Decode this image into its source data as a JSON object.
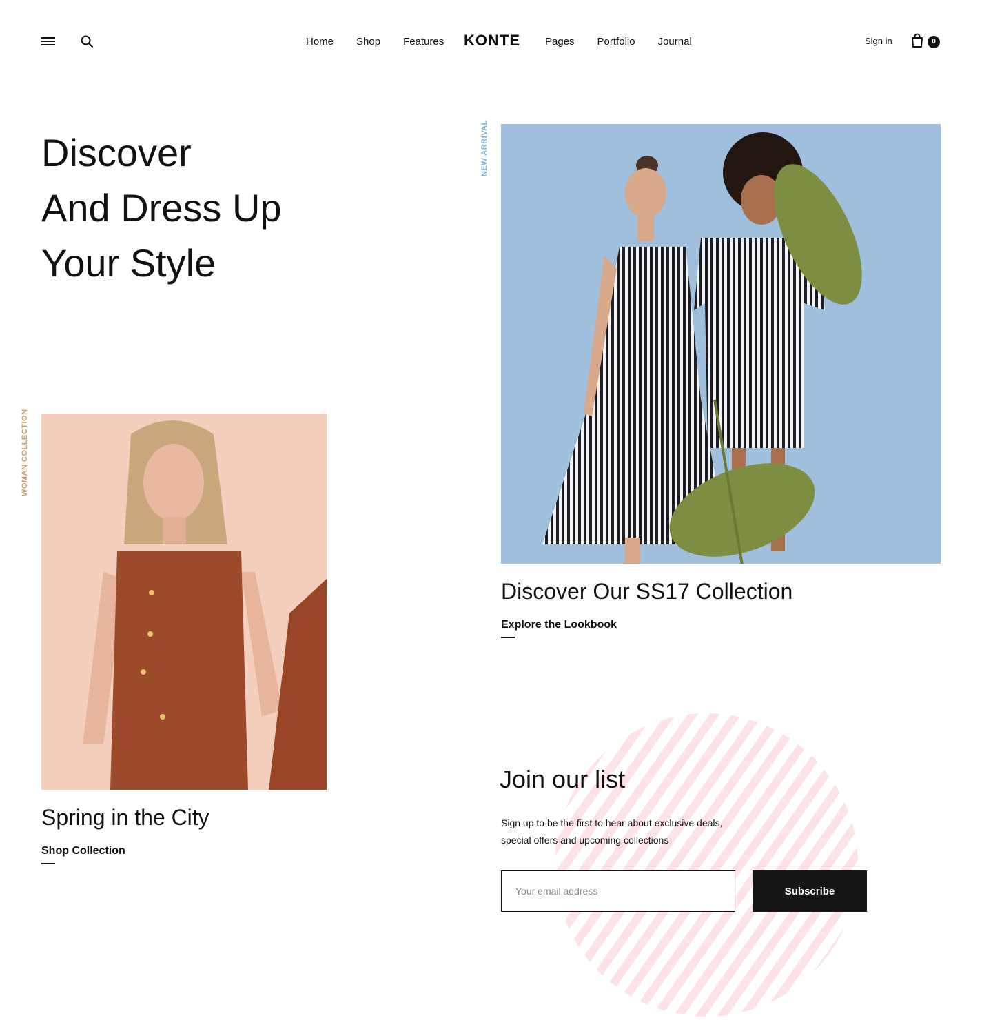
{
  "header": {
    "logo": "KONTE",
    "nav_left": [
      "Home",
      "Shop",
      "Features"
    ],
    "nav_right": [
      "Pages",
      "Portfolio",
      "Journal"
    ],
    "signin_label": "Sign in",
    "cart_count": "0",
    "icons": [
      "hamburger-menu-icon",
      "search-icon",
      "shopping-bag-icon"
    ]
  },
  "hero": {
    "title_lines": [
      "Discover",
      "And Dress Up",
      "Your Style"
    ]
  },
  "feature_right": {
    "tag": "NEW ARRIVAL",
    "tag_color": "#7fb2d6",
    "title": "Discover Our SS17 Collection",
    "link": "Explore the Lookbook",
    "image_bg": "#9fbfdc"
  },
  "feature_left": {
    "tag": "WOMAN COLLECTION",
    "tag_color": "#d99a66",
    "title": "Spring in the City",
    "link": "Shop Collection",
    "image_bg": "#f5cfbd"
  },
  "newsletter": {
    "title": "Join our list",
    "description": "Sign up to be the first to hear about exclusive deals, special offers and upcoming collections",
    "email_placeholder": "Your email address",
    "subscribe_label": "Subscribe",
    "accent_color": "#fde3e5"
  }
}
